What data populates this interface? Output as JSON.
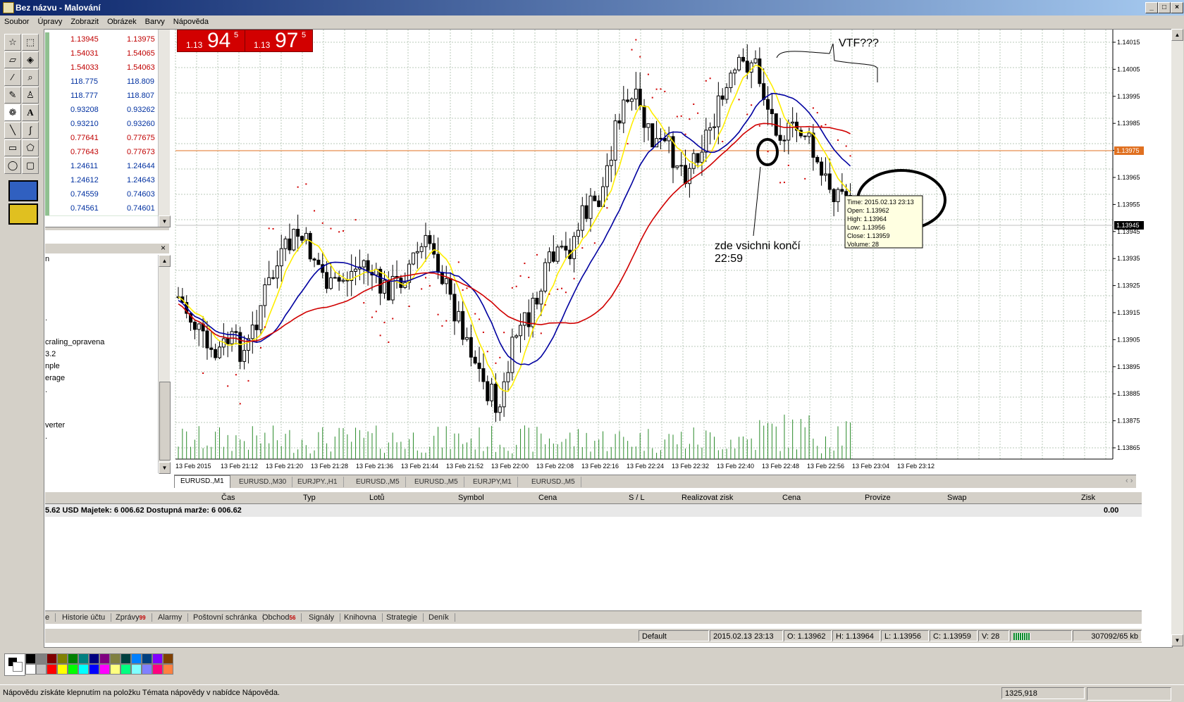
{
  "window": {
    "title": "Bez názvu - Malování",
    "minimize": "_",
    "maximize": "□",
    "close": "×"
  },
  "menu": [
    "Soubor",
    "Úpravy",
    "Zobrazit",
    "Obrázek",
    "Barvy",
    "Nápověda"
  ],
  "quotes": {
    "bid1": {
      "big": "94",
      "prefix": "1.13",
      "sup": "5"
    },
    "bid2": {
      "big": "97",
      "prefix": "1.13",
      "sup": "5"
    }
  },
  "market_watch": [
    [
      "1.13945",
      "1.13975"
    ],
    [
      "1.54031",
      "1.54065"
    ],
    [
      "1.54033",
      "1.54063"
    ],
    [
      "118.775",
      "118.809"
    ],
    [
      "118.777",
      "118.807"
    ],
    [
      "0.93208",
      "0.93262"
    ],
    [
      "0.93210",
      "0.93260"
    ],
    [
      "0.77641",
      "0.77675"
    ],
    [
      "0.77643",
      "0.77673"
    ],
    [
      "1.24611",
      "1.24644"
    ],
    [
      "1.24612",
      "1.24643"
    ],
    [
      "0.74559",
      "0.74603"
    ],
    [
      "0.74561",
      "0.74601"
    ]
  ],
  "navigator": {
    "items": [
      "n",
      ".",
      "craling_opravena",
      "3.2",
      "nple",
      "erage",
      ".",
      "verter",
      "."
    ]
  },
  "chart_data": {
    "type": "candlestick",
    "symbol": "EURUSD.,M1",
    "ylim": [
      1.1386,
      1.1402
    ],
    "y_ticks": [
      "1.14015",
      "1.14005",
      "1.13995",
      "1.13985",
      "1.13975",
      "1.13965",
      "1.13955",
      "1.13945",
      "1.13935",
      "1.13925",
      "1.13915",
      "1.13905",
      "1.13895",
      "1.13885",
      "1.13875",
      "1.13865"
    ],
    "x_ticks": [
      "13 Feb 2015",
      "13 Feb 21:12",
      "13 Feb 21:20",
      "13 Feb 21:28",
      "13 Feb 21:36",
      "13 Feb 21:44",
      "13 Feb 21:52",
      "13 Feb 22:00",
      "13 Feb 22:08",
      "13 Feb 22:16",
      "13 Feb 22:24",
      "13 Feb 22:32",
      "13 Feb 22:40",
      "13 Feb 22:48",
      "13 Feb 22:56",
      "13 Feb 23:04",
      "13 Feb 23:12"
    ],
    "ask_level": "1.13975",
    "bid_level": "1.13945",
    "annotations": [
      "VTF???",
      "zde vsichni končí",
      "22:59"
    ],
    "tooltip": [
      "Time: 2015.02.13 23:13",
      "Open: 1.13962",
      "High: 1.13964",
      "Low: 1.13956",
      "Close: 1.13959",
      "Volume: 28"
    ]
  },
  "chart_tabs": [
    "EURUSD.,M1",
    "EURUSD.,M30",
    "EURJPY.,H1",
    "EURUSD.,M5",
    "EURUSD.,M5",
    "EURJPY,M1",
    "EURUSD.,M5"
  ],
  "terminal": {
    "columns": [
      "Čas",
      "Typ",
      "Lotů",
      "Symbol",
      "Cena",
      "S / L",
      "Realizovat zisk",
      "Cena",
      "Provize",
      "Swap",
      "Zisk"
    ],
    "balance": "5.62 USD  Majetek: 6 006.62  Dostupná marže: 6 006.62",
    "balance_value": "0.00",
    "tabs": [
      {
        "label": "e"
      },
      {
        "label": "Historie účtu"
      },
      {
        "label": "Zprávy",
        "badge": "99"
      },
      {
        "label": "Alarmy"
      },
      {
        "label": "Poštovní schránka"
      },
      {
        "label": "Obchod",
        "badge": "56"
      },
      {
        "label": "Signály"
      },
      {
        "label": "Knihovna"
      },
      {
        "label": "Strategie"
      },
      {
        "label": "Deník"
      }
    ]
  },
  "status": {
    "profile": "Default",
    "time": "2015.02.13 23:13",
    "open": "O: 1.13962",
    "high": "H: 1.13964",
    "low": "L: 1.13956",
    "close": "C: 1.13959",
    "volume": "V: 28",
    "memory": "307092/65 kb"
  },
  "paint_status": {
    "message": "Nápovědu získáte klepnutím na položku Témata nápovědy v nabídce Nápověda.",
    "coords": "1325,918"
  },
  "palette": [
    "#000000",
    "#808080",
    "#800000",
    "#808000",
    "#008000",
    "#008080",
    "#000080",
    "#800080",
    "#808040",
    "#004040",
    "#0080ff",
    "#004080",
    "#8000ff",
    "#804000",
    "#ffffff",
    "#c0c0c0",
    "#ff0000",
    "#ffff00",
    "#00ff00",
    "#00ffff",
    "#0000ff",
    "#ff00ff",
    "#ffff80",
    "#00ff80",
    "#80ffff",
    "#8080ff",
    "#ff0080",
    "#ff8040"
  ]
}
